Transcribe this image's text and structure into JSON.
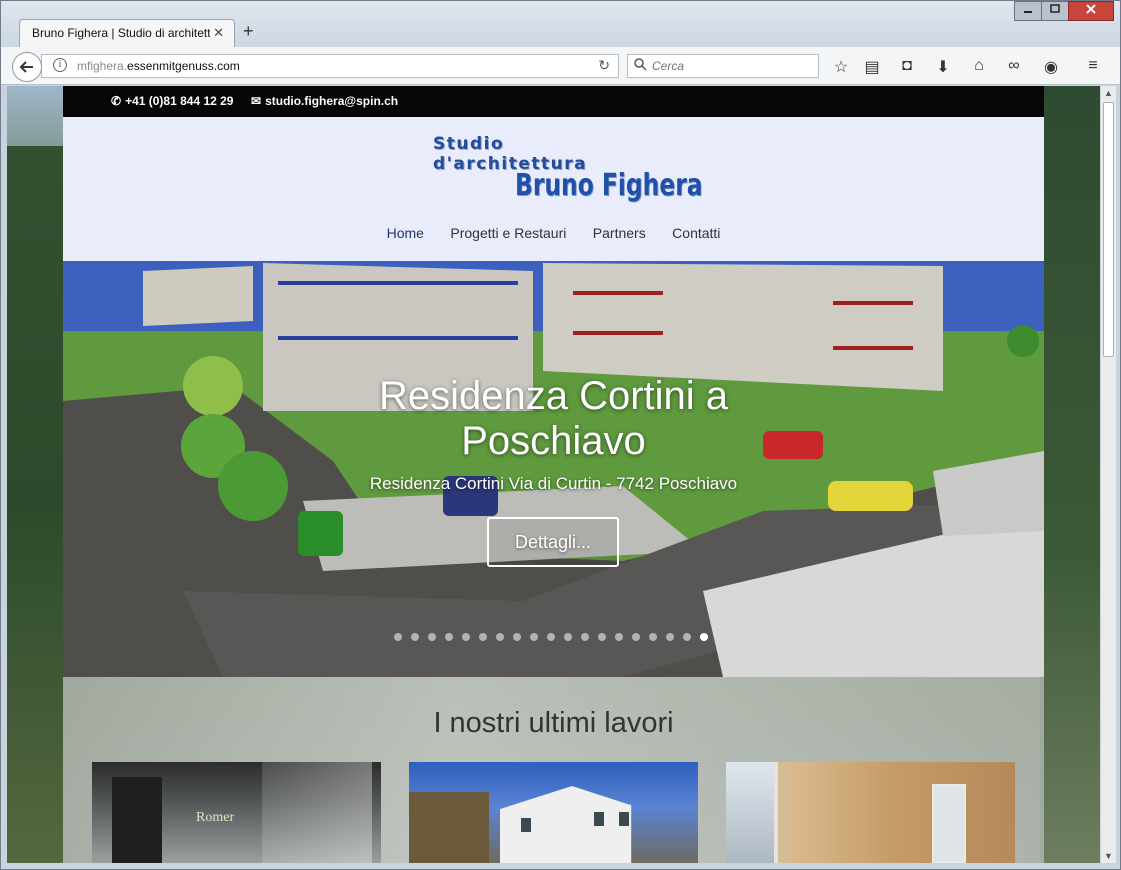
{
  "browser": {
    "tab_title": "Bruno Fighera | Studio di architett",
    "tab_close": "✕",
    "new_tab": "+",
    "url_sub": "mfighera.",
    "url_domain": "essenmitgenuss.com",
    "search_placeholder": "Cerca"
  },
  "topbar": {
    "phone": "+41 (0)81 844 12 29",
    "email": "studio.fighera@spin.ch"
  },
  "logo": {
    "line1": "Studio d'architettura",
    "line2": "Bruno Fighera"
  },
  "menu": {
    "items": [
      "Home",
      "Progetti e Restauri",
      "Partners",
      "Contatti"
    ]
  },
  "hero": {
    "title_line1": "Residenza Cortini a",
    "title_line2": "Poschiavo",
    "subtitle": "Residenza Cortini Via di Curtin - 7742 Poschiavo",
    "button_label": "Dettagli...",
    "slide_count": 19,
    "active_slide": 19
  },
  "works": {
    "title": "I nostri ultimi lavori",
    "thumb1_sign": "Romer"
  },
  "colors": {
    "header_bg": "#e8ecfb",
    "logo_blue": "#2050a8",
    "topbar_bg": "#060606"
  }
}
